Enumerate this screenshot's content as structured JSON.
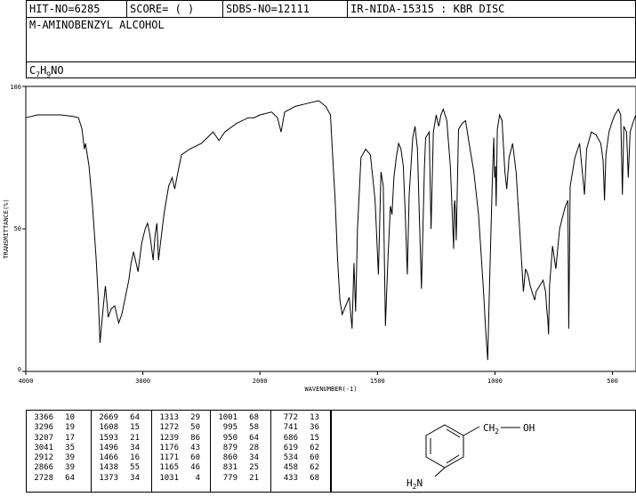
{
  "header": {
    "hit_no": "HIT-NO=6285",
    "score": "SCORE=  (   )",
    "sdbs_no": "SDBS-NO=12111",
    "ir_nida": "IR-NIDA-15315 : KBR DISC",
    "compound_name": "M-AMINOBENZYL ALCOHOL",
    "formula": {
      "c": "C",
      "c_sub": "7",
      "h": "H",
      "h_sub": "9",
      "rest": "NO"
    }
  },
  "chart_data": {
    "type": "line",
    "xlabel": "WAVENUMBER(-1)",
    "ylabel": "TRANSMITTANCE(%)",
    "xlim": [
      4000,
      400
    ],
    "ylim": [
      0,
      100
    ],
    "x_ticks": [
      4000,
      3000,
      2000,
      1500,
      1000,
      500
    ],
    "y_ticks": [
      0,
      50,
      100
    ],
    "series": [
      {
        "points": [
          [
            4000,
            89
          ],
          [
            3900,
            90
          ],
          [
            3800,
            90
          ],
          [
            3700,
            90
          ],
          [
            3600,
            89.5
          ],
          [
            3550,
            89
          ],
          [
            3520,
            85
          ],
          [
            3500,
            78
          ],
          [
            3490,
            80
          ],
          [
            3460,
            72
          ],
          [
            3430,
            58
          ],
          [
            3400,
            40
          ],
          [
            3380,
            25
          ],
          [
            3366,
            10
          ],
          [
            3340,
            22
          ],
          [
            3320,
            30
          ],
          [
            3296,
            19
          ],
          [
            3270,
            22
          ],
          [
            3240,
            23
          ],
          [
            3207,
            17
          ],
          [
            3180,
            20
          ],
          [
            3150,
            26
          ],
          [
            3120,
            32
          ],
          [
            3100,
            38
          ],
          [
            3080,
            42
          ],
          [
            3041,
            35
          ],
          [
            3010,
            45
          ],
          [
            2980,
            50
          ],
          [
            2960,
            52
          ],
          [
            2940,
            48
          ],
          [
            2912,
            39
          ],
          [
            2895,
            48
          ],
          [
            2880,
            52
          ],
          [
            2866,
            39
          ],
          [
            2850,
            45
          ],
          [
            2820,
            55
          ],
          [
            2800,
            60
          ],
          [
            2780,
            65
          ],
          [
            2750,
            68
          ],
          [
            2728,
            64
          ],
          [
            2700,
            70
          ],
          [
            2670,
            76
          ],
          [
            2600,
            78
          ],
          [
            2500,
            80
          ],
          [
            2450,
            82
          ],
          [
            2400,
            84
          ],
          [
            2350,
            81
          ],
          [
            2300,
            84
          ],
          [
            2200,
            87
          ],
          [
            2100,
            89
          ],
          [
            2050,
            89
          ],
          [
            2000,
            90
          ],
          [
            1950,
            91
          ],
          [
            1925,
            89
          ],
          [
            1910,
            84
          ],
          [
            1895,
            91
          ],
          [
            1850,
            93
          ],
          [
            1800,
            94
          ],
          [
            1750,
            95
          ],
          [
            1720,
            93
          ],
          [
            1700,
            90
          ],
          [
            1690,
            75
          ],
          [
            1680,
            60
          ],
          [
            1670,
            40
          ],
          [
            1660,
            25
          ],
          [
            1650,
            20
          ],
          [
            1620,
            26
          ],
          [
            1608,
            15
          ],
          [
            1600,
            38
          ],
          [
            1593,
            21
          ],
          [
            1585,
            50
          ],
          [
            1570,
            75
          ],
          [
            1550,
            78
          ],
          [
            1530,
            76
          ],
          [
            1510,
            60
          ],
          [
            1496,
            34
          ],
          [
            1485,
            70
          ],
          [
            1475,
            65
          ],
          [
            1466,
            16
          ],
          [
            1455,
            40
          ],
          [
            1445,
            58
          ],
          [
            1438,
            55
          ],
          [
            1430,
            68
          ],
          [
            1420,
            75
          ],
          [
            1410,
            80
          ],
          [
            1400,
            78
          ],
          [
            1390,
            72
          ],
          [
            1382,
            56
          ],
          [
            1373,
            34
          ],
          [
            1365,
            62
          ],
          [
            1350,
            82
          ],
          [
            1340,
            86
          ],
          [
            1330,
            78
          ],
          [
            1313,
            29
          ],
          [
            1300,
            72
          ],
          [
            1295,
            82
          ],
          [
            1280,
            84
          ],
          [
            1272,
            50
          ],
          [
            1262,
            84
          ],
          [
            1250,
            90
          ],
          [
            1245,
            88
          ],
          [
            1239,
            86
          ],
          [
            1230,
            90
          ],
          [
            1220,
            92
          ],
          [
            1205,
            88
          ],
          [
            1190,
            72
          ],
          [
            1176,
            43
          ],
          [
            1173,
            58
          ],
          [
            1171,
            60
          ],
          [
            1168,
            55
          ],
          [
            1165,
            46
          ],
          [
            1155,
            85
          ],
          [
            1140,
            87
          ],
          [
            1125,
            88
          ],
          [
            1110,
            80
          ],
          [
            1090,
            70
          ],
          [
            1070,
            55
          ],
          [
            1050,
            30
          ],
          [
            1040,
            15
          ],
          [
            1031,
            4
          ],
          [
            1025,
            25
          ],
          [
            1012,
            65
          ],
          [
            1005,
            82
          ],
          [
            1001,
            68
          ],
          [
            998,
            72
          ],
          [
            995,
            58
          ],
          [
            990,
            85
          ],
          [
            980,
            90
          ],
          [
            970,
            88
          ],
          [
            958,
            70
          ],
          [
            950,
            64
          ],
          [
            940,
            75
          ],
          [
            925,
            80
          ],
          [
            910,
            70
          ],
          [
            895,
            50
          ],
          [
            879,
            28
          ],
          [
            870,
            36
          ],
          [
            860,
            34
          ],
          [
            850,
            30
          ],
          [
            835,
            26
          ],
          [
            831,
            25
          ],
          [
            825,
            28
          ],
          [
            810,
            30
          ],
          [
            795,
            32
          ],
          [
            785,
            28
          ],
          [
            779,
            21
          ],
          [
            775,
            18
          ],
          [
            772,
            13
          ],
          [
            768,
            30
          ],
          [
            755,
            44
          ],
          [
            741,
            36
          ],
          [
            725,
            50
          ],
          [
            710,
            55
          ],
          [
            700,
            58
          ],
          [
            690,
            60
          ],
          [
            686,
            15
          ],
          [
            680,
            65
          ],
          [
            660,
            75
          ],
          [
            640,
            80
          ],
          [
            619,
            62
          ],
          [
            610,
            78
          ],
          [
            590,
            84
          ],
          [
            570,
            83
          ],
          [
            550,
            80
          ],
          [
            540,
            74
          ],
          [
            534,
            60
          ],
          [
            528,
            76
          ],
          [
            515,
            84
          ],
          [
            500,
            88
          ],
          [
            490,
            90
          ],
          [
            475,
            92
          ],
          [
            465,
            90
          ],
          [
            458,
            62
          ],
          [
            452,
            86
          ],
          [
            440,
            84
          ],
          [
            433,
            68
          ],
          [
            425,
            84
          ],
          [
            410,
            88
          ],
          [
            400,
            90
          ]
        ]
      }
    ]
  },
  "peaks": [
    [
      [
        "3366",
        "10"
      ],
      [
        "3296",
        "19"
      ],
      [
        "3207",
        "17"
      ],
      [
        "3041",
        "35"
      ],
      [
        "2912",
        "39"
      ],
      [
        "2866",
        "39"
      ],
      [
        "2728",
        "64"
      ]
    ],
    [
      [
        "2669",
        "64"
      ],
      [
        "1608",
        "15"
      ],
      [
        "1593",
        "21"
      ],
      [
        "1496",
        "34"
      ],
      [
        "1466",
        "16"
      ],
      [
        "1438",
        "55"
      ],
      [
        "1373",
        "34"
      ]
    ],
    [
      [
        "1313",
        "29"
      ],
      [
        "1272",
        "50"
      ],
      [
        "1239",
        "86"
      ],
      [
        "1176",
        "43"
      ],
      [
        "1171",
        "60"
      ],
      [
        "1165",
        "46"
      ],
      [
        "1031",
        "4"
      ]
    ],
    [
      [
        "1001",
        "68"
      ],
      [
        "995",
        "58"
      ],
      [
        "950",
        "64"
      ],
      [
        "879",
        "28"
      ],
      [
        "860",
        "34"
      ],
      [
        "831",
        "25"
      ],
      [
        "779",
        "21"
      ]
    ],
    [
      [
        "772",
        "13"
      ],
      [
        "741",
        "36"
      ],
      [
        "686",
        "15"
      ],
      [
        "619",
        "62"
      ],
      [
        "534",
        "60"
      ],
      [
        "458",
        "62"
      ],
      [
        "433",
        "68"
      ]
    ]
  ],
  "structure": {
    "substituent": "CH",
    "substituent_sub": "2",
    "oh": "OH",
    "amine_h": "H",
    "amine_sub": "2",
    "amine_n": "N"
  }
}
